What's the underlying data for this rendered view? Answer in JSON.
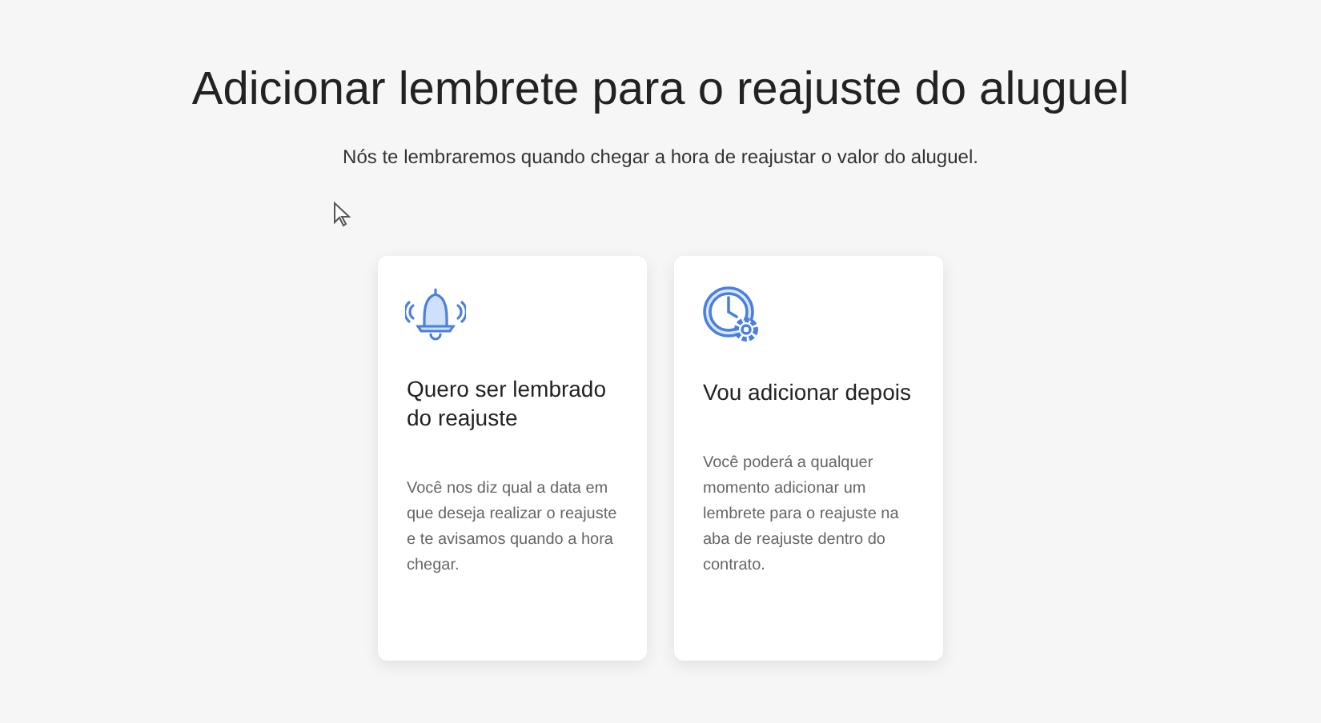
{
  "title": "Adicionar lembrete para o reajuste do aluguel",
  "subtitle": "Nós te lembraremos quando chegar a hora de reajustar o valor do aluguel.",
  "options": [
    {
      "kind": "bell",
      "heading": "Quero ser lembrado do reajuste",
      "description": "Você nos diz qual a data em que deseja realizar o reajuste e te avisamos quando a hora chegar."
    },
    {
      "kind": "clock",
      "heading": "Vou adicionar depois",
      "description": "Você poderá a qualquer momento adicionar um lembrete para o reajuste na aba de reajuste dentro do contrato."
    }
  ]
}
